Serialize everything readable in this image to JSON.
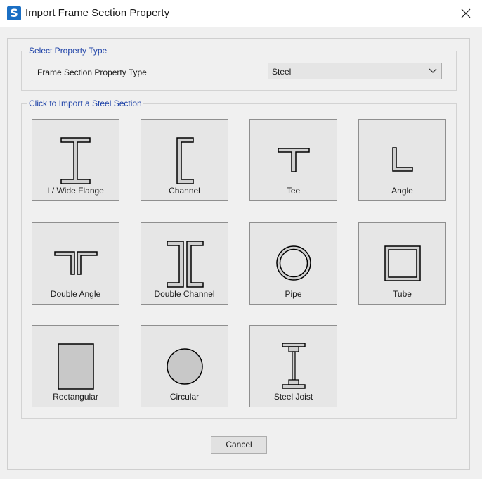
{
  "window": {
    "app_icon_letter": "S",
    "title": "Import Frame Section Property"
  },
  "property_type_group": {
    "title": "Select Property Type",
    "field_label": "Frame Section Property Type",
    "selected_value": "Steel"
  },
  "sections_group": {
    "title": "Click to Import a Steel Section",
    "tiles": [
      {
        "label": "I / Wide Flange",
        "icon": "wide-flange-icon"
      },
      {
        "label": "Channel",
        "icon": "channel-icon"
      },
      {
        "label": "Tee",
        "icon": "tee-icon"
      },
      {
        "label": "Angle",
        "icon": "angle-icon"
      },
      {
        "label": "Double Angle",
        "icon": "double-angle-icon"
      },
      {
        "label": "Double Channel",
        "icon": "double-channel-icon"
      },
      {
        "label": "Pipe",
        "icon": "pipe-icon"
      },
      {
        "label": "Tube",
        "icon": "tube-icon"
      },
      {
        "label": "Rectangular",
        "icon": "rectangular-icon"
      },
      {
        "label": "Circular",
        "icon": "circular-icon"
      },
      {
        "label": "Steel Joist",
        "icon": "steel-joist-icon"
      }
    ]
  },
  "buttons": {
    "cancel": "Cancel"
  },
  "colors": {
    "group_title": "#1a3fa6",
    "app_icon": "#1b6fc4",
    "tile_background": "#e6e6e6",
    "shape_fill": "#d0d0d0"
  }
}
